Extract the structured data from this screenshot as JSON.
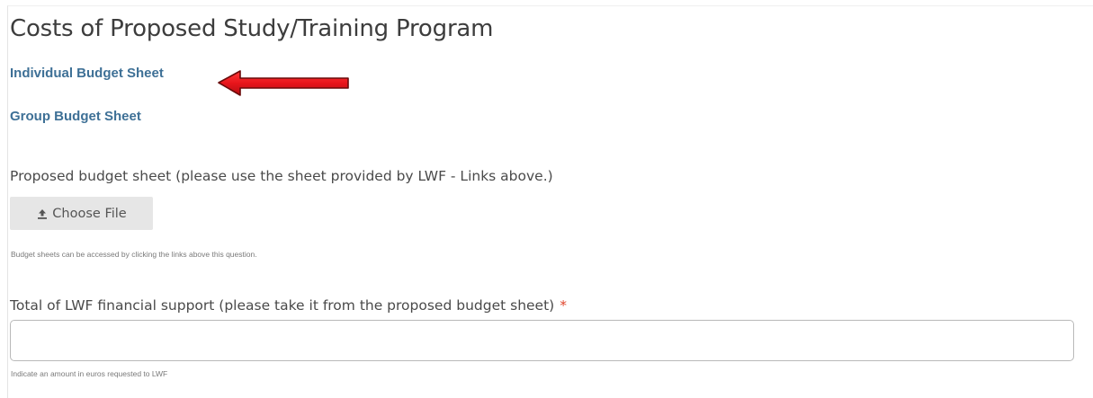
{
  "section": {
    "title": "Costs of Proposed Study/Training Program"
  },
  "links": {
    "individual_budget_sheet": "Individual Budget Sheet",
    "group_budget_sheet": "Group Budget Sheet"
  },
  "budget_field": {
    "label": "Proposed budget sheet (please use the sheet provided by LWF - Links above.)",
    "button_label": "Choose File",
    "button_icon": "upload-icon",
    "help_text": "Budget sheets can be accessed by clicking the links above this question."
  },
  "total_field": {
    "label": "Total of LWF financial support (please take it from the proposed budget sheet)",
    "required_marker": "*",
    "value": "",
    "help_text": "Indicate an amount in euros requested to LWF"
  },
  "annotation": {
    "icon": "red-arrow-icon",
    "color": "#e8151b"
  },
  "colors": {
    "link": "#3e7096",
    "required": "#e0452c",
    "button_bg": "#e6e6e6"
  }
}
